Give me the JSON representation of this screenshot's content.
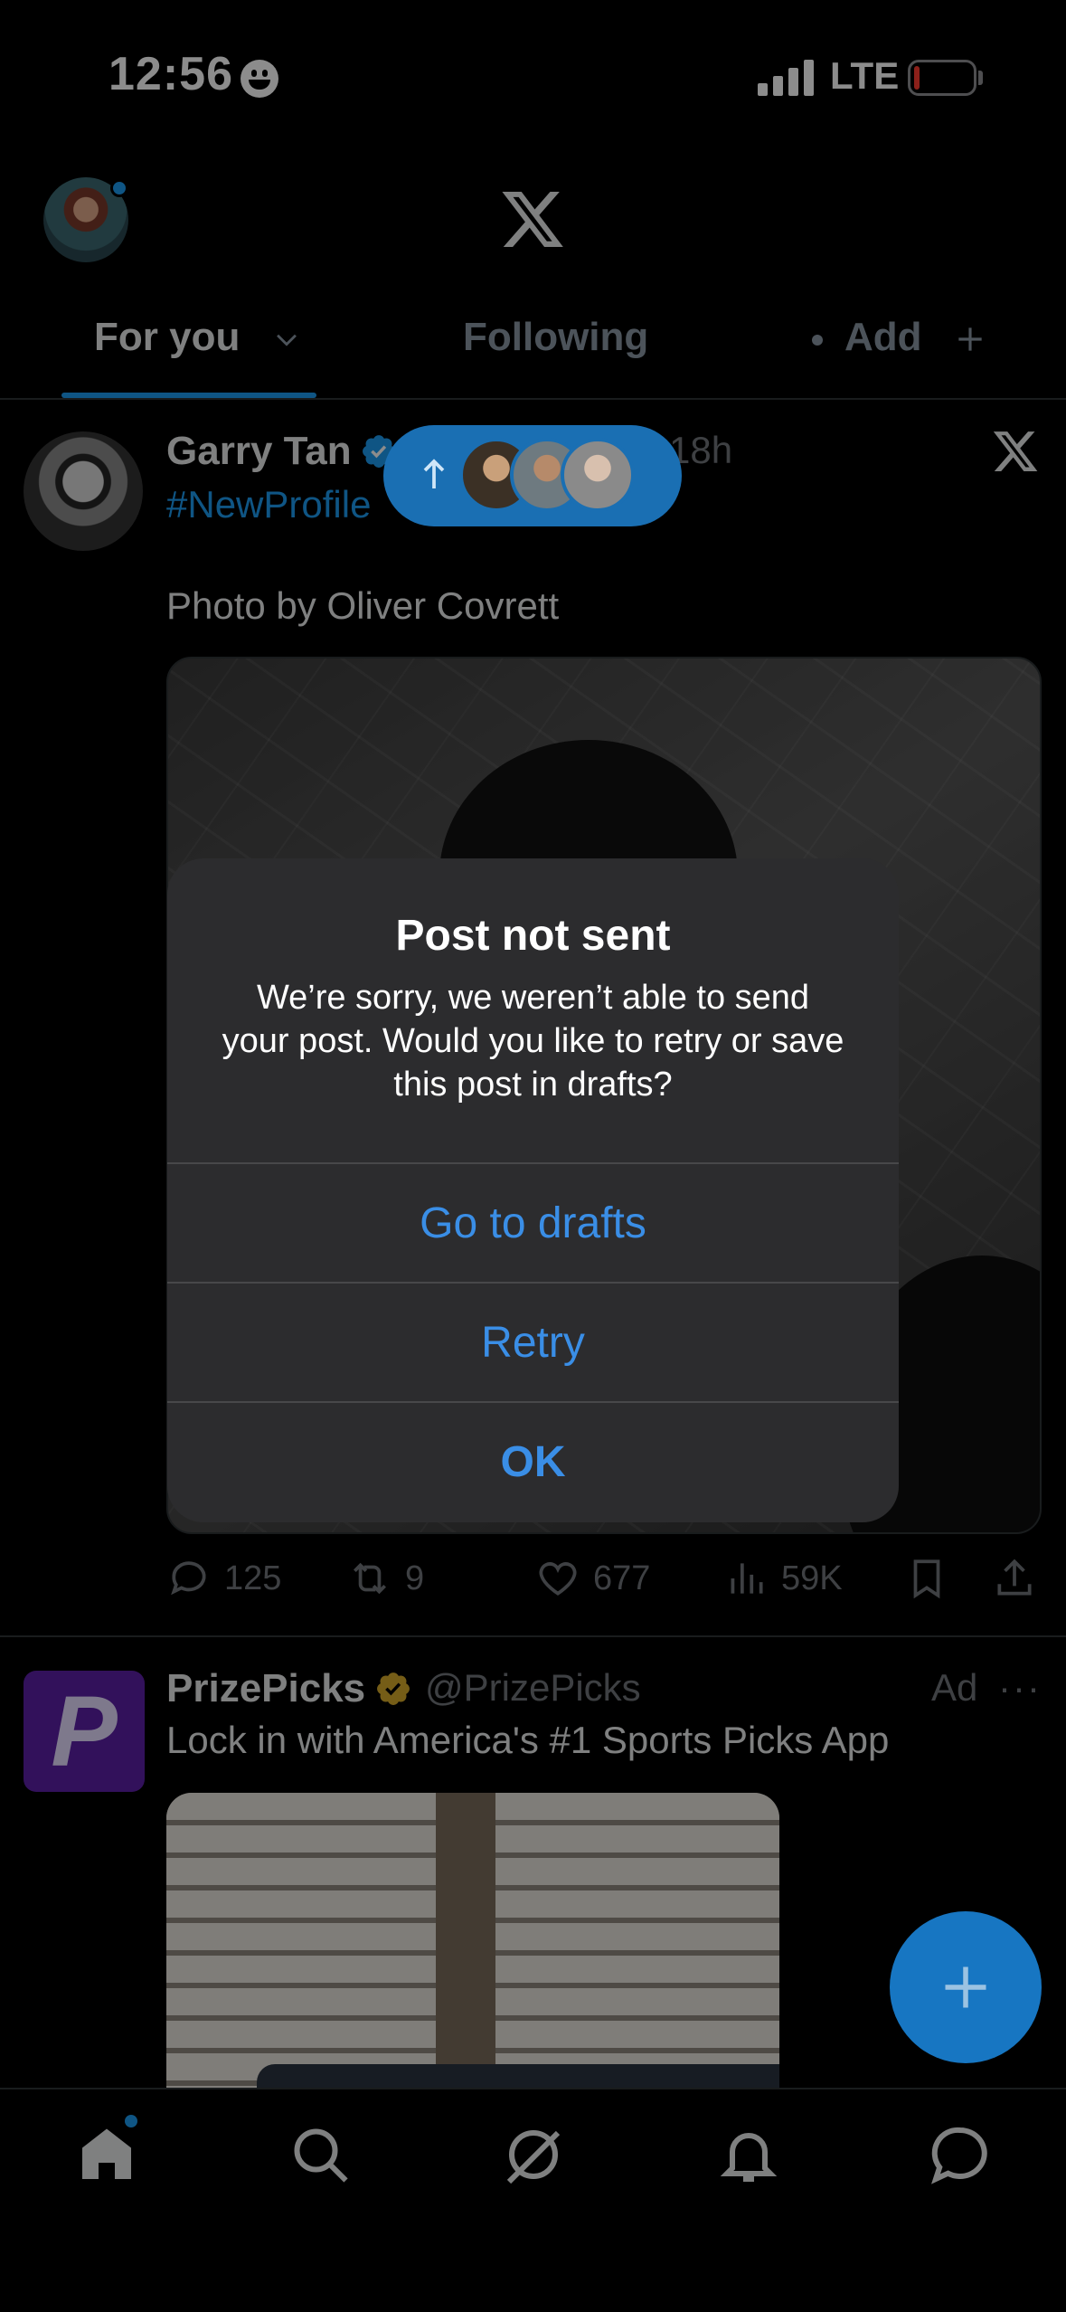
{
  "status_bar": {
    "time": "12:56",
    "network": "LTE"
  },
  "tabs": {
    "for_you": "For you",
    "following": "Following",
    "add": "Add"
  },
  "post1": {
    "author": "Garry Tan",
    "time": "18h",
    "hashtag": "#NewProfile",
    "text": "Photo by Oliver Covrett",
    "replies": "125",
    "reposts": "9",
    "likes": "677",
    "views": "59K"
  },
  "post2": {
    "author": "PrizePicks",
    "handle": "@PrizePicks",
    "ad_label": "Ad",
    "more": "···",
    "text": "Lock in with America's #1 Sports Picks App"
  },
  "alert": {
    "title": "Post not sent",
    "message": "We’re sorry, we weren’t able to send your post. Would you like to retry or save this post in drafts?",
    "button_drafts": "Go to drafts",
    "button_retry": "Retry",
    "button_ok": "OK"
  },
  "colors": {
    "accent": "#1d9bf0",
    "alert_button": "#3a8ee6",
    "alert_bg": "#2c2c2e",
    "prizepicks": "#5b1fa6"
  },
  "icons": [
    "home-icon",
    "search-icon",
    "grok-icon",
    "notifications-icon",
    "messages-icon",
    "compose-icon"
  ]
}
